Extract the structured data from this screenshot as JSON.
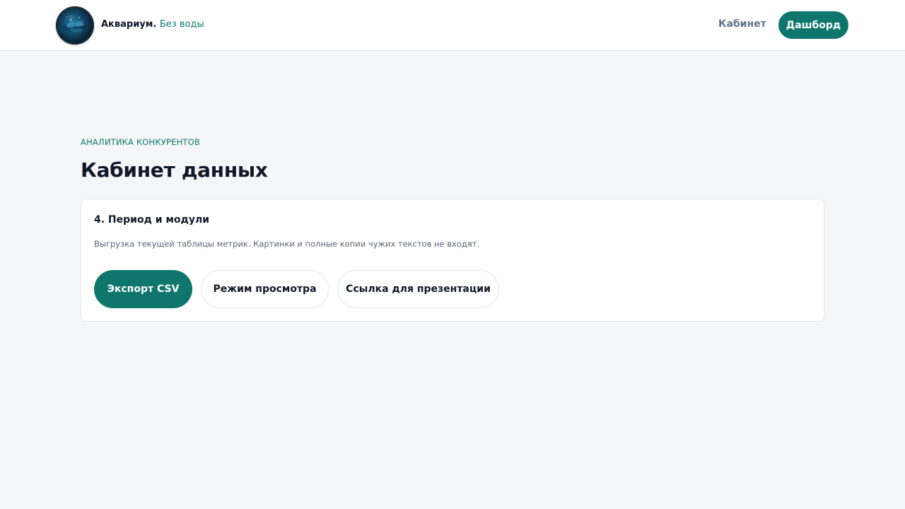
{
  "header": {
    "brand_name": "Аквариум.",
    "brand_tagline": "Без воды",
    "nav_link": "Кабинет",
    "nav_button": "Дашборд",
    "logo_icon": "aquarium-globe-icon"
  },
  "main": {
    "eyebrow": "АНАЛИТИКА КОНКУРЕНТОВ",
    "title": "Кабинет данных",
    "card": {
      "title": "4. Период и модули",
      "description": "Выгрузка текущей таблицы метрик. Картинки и полные копии чужих текстов не входят.",
      "buttons": {
        "export": "Экспорт CSV",
        "view_mode": "Режим просмотра",
        "share_link": "Ссылка для презентации"
      }
    }
  },
  "colors": {
    "accent": "#0f766e",
    "background": "#f4f6f9",
    "surface": "#ffffff"
  }
}
